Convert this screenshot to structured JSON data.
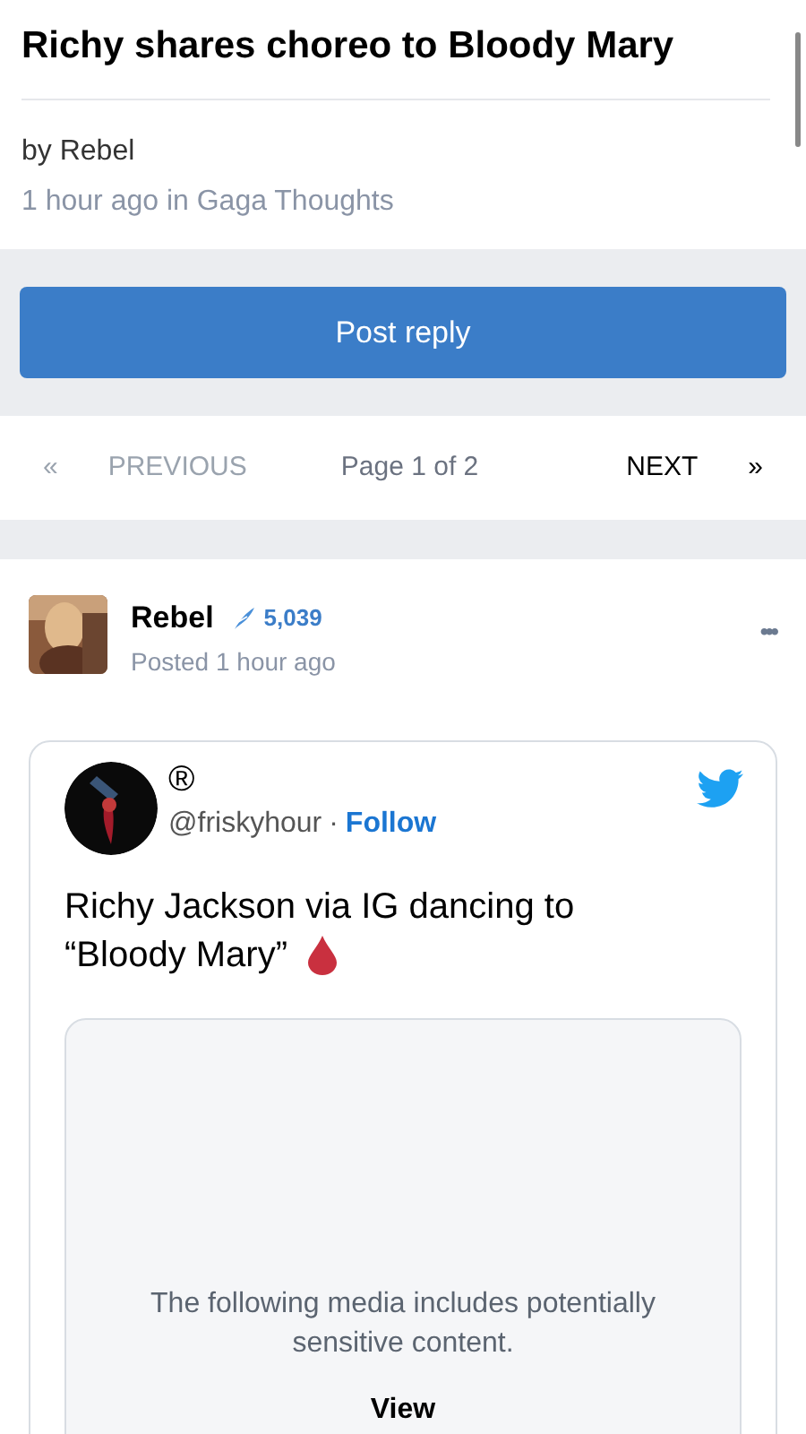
{
  "topic": {
    "title": "Richy shares choreo to Bloody Mary",
    "author": "by Rebel",
    "meta": "1 hour ago in Gaga Thoughts"
  },
  "reply_button": "Post reply",
  "pagination": {
    "previous": {
      "arrow": "«",
      "label": "PREVIOUS",
      "disabled": true
    },
    "page": "Page 1 of 2",
    "next": {
      "label": "NEXT",
      "arrow": "»",
      "disabled": false
    }
  },
  "post": {
    "author": "Rebel",
    "reputation": "5,039",
    "posted": "Posted 1 hour ago",
    "more": "•••",
    "embed": {
      "display_name": "®",
      "handle": "@friskyhour",
      "separator": "·",
      "follow": "Follow",
      "text_lines": [
        "Richy Jackson via IG dancing to",
        "“Bloody Mary”"
      ],
      "media_notice": "The following media includes potentially sensitive content.",
      "view": "View"
    }
  }
}
